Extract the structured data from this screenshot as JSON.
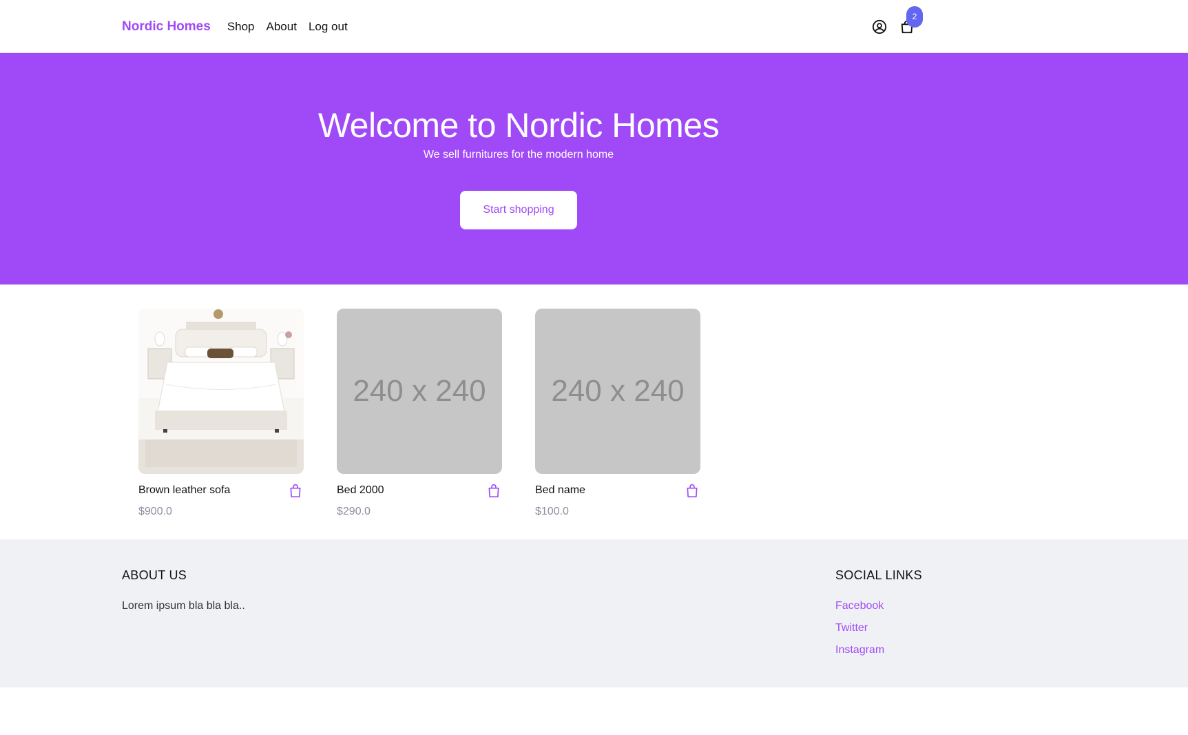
{
  "nav": {
    "brand": "Nordic Homes",
    "links": [
      "Shop",
      "About",
      "Log out"
    ],
    "cart_count": "2",
    "icons": [
      "user-circle-icon",
      "shopping-bag-icon"
    ]
  },
  "hero": {
    "title": "Welcome to Nordic Homes",
    "subtitle": "We sell furnitures for the modern home",
    "cta_label": "Start shopping"
  },
  "products": [
    {
      "name": "Brown leather sofa",
      "price": "$900.0",
      "image": "bed-photo"
    },
    {
      "name": "Bed 2000",
      "price": "$290.0",
      "image_placeholder": "240 x 240"
    },
    {
      "name": "Bed name",
      "price": "$100.0",
      "image_placeholder": "240 x 240"
    }
  ],
  "footer": {
    "about_heading": "ABOUT US",
    "about_text": "Lorem ipsum bla bla bla..",
    "social_heading": "SOCIAL LINKS",
    "social_links": [
      "Facebook",
      "Twitter",
      "Instagram"
    ]
  },
  "colors": {
    "brand": "#a04af7",
    "badge": "#6366f1",
    "footer_bg": "#f0f1f4",
    "placeholder_bg": "#c6c6c6"
  }
}
